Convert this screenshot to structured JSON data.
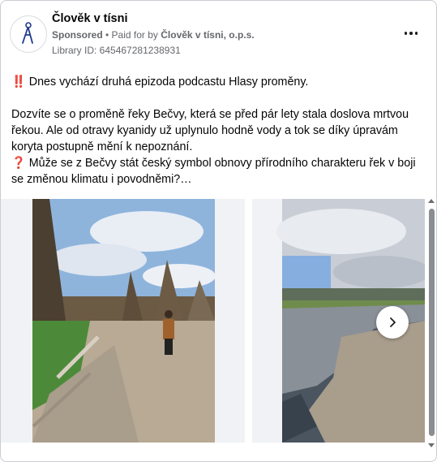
{
  "header": {
    "page_name": "Člověk v tísni",
    "sponsored_label": "Sponsored",
    "paid_for_prefix": " • Paid for by ",
    "paid_for_by": "Člověk v tísni, o.p.s.",
    "library_id": "Library ID: 645467281238931",
    "logo_letter": "A"
  },
  "post": {
    "line1": "‼️ Dnes vychází druhá epizoda podcastu Hlasy proměny.",
    "para2": "Dozvíte se o proměně řeky Bečvy, která se před pár lety stala doslova mrtvou řekou. Ale od otravy kyanidy už uplynulo hodně vody a tok se díky úpravám koryta postupně mění k nepoznání.",
    "para3": "❓ Může se z Bečvy stát český symbol obnovy přírodního charakteru řek v boji se změnou klimatu i povodněmi?…"
  },
  "colors": {
    "sky": "#8fb4dc",
    "grass": "#4c8a3a",
    "water": "#4a5560",
    "gravel": "#a99d8c"
  },
  "icons": {
    "more": "more-options-icon",
    "next": "chevron-right-icon",
    "logo": "person-logo-icon"
  }
}
